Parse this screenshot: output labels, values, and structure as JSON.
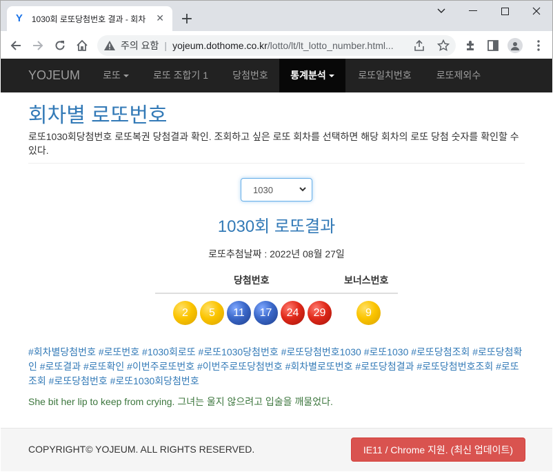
{
  "browser": {
    "tab_title": "1030회 로또당첨번호 결과 - 회차",
    "omnibox_warning": "주의 요함",
    "url_host": "yojeum.dothome.co.kr",
    "url_path": "/lotto/lt/lt_lotto_number.html..."
  },
  "navbar": {
    "brand": "YOJEUM",
    "items": [
      {
        "label": "로또",
        "dropdown": true
      },
      {
        "label": "로또 조합기 1"
      },
      {
        "label": "당첨번호"
      },
      {
        "label": "통계분석",
        "dropdown": true,
        "active": true
      },
      {
        "label": "로또일치번호"
      },
      {
        "label": "로또제외수"
      }
    ]
  },
  "page": {
    "title": "회차별 로또번호",
    "description": "로또1030회당첨번호 로또복권 당첨결과 확인. 조회하고 싶은 로또 회차를 선택하면 해당 회차의 로또 당첨 숫자를 확인할 수 있다.",
    "round_select_value": "1030",
    "draw_title": "1030회 로또결과",
    "draw_date": "로또추첨날짜 : 2022년 08월 27일",
    "winning_header": "당첨번호",
    "bonus_header": "보너스번호",
    "winning_numbers": [
      {
        "number": "2",
        "color": "#fbc400"
      },
      {
        "number": "5",
        "color": "#fbc400"
      },
      {
        "number": "11",
        "color": "#3a67c8"
      },
      {
        "number": "17",
        "color": "#3a67c8"
      },
      {
        "number": "24",
        "color": "#e0291a"
      },
      {
        "number": "29",
        "color": "#e0291a"
      }
    ],
    "bonus_number": {
      "number": "9",
      "color": "#fbc400"
    },
    "tags": "#회차별당첨번호 #로또번호 #1030회로또 #로또1030당첨번호 #로또당첨번호1030 #로또1030 #로또당첨조회 #로또당첨확인 #로또결과 #로또확인 #이번주로또번호 #이번주로또당첨번호 #회차별로또번호 #로또당첨결과 #로또당첨번호조회 #로또조회 #로또당첨번호 #로또1030회당첨번호",
    "quote": "She bit her lip to keep from crying. 그녀는 울지 않으려고 입술을 깨물었다."
  },
  "footer": {
    "copyright": "COPYRIGHT© YOJEUM. ALL RIGHTS RESERVED.",
    "browser_notice": "IE11 / Chrome 지원. (최신 업데이트)"
  }
}
